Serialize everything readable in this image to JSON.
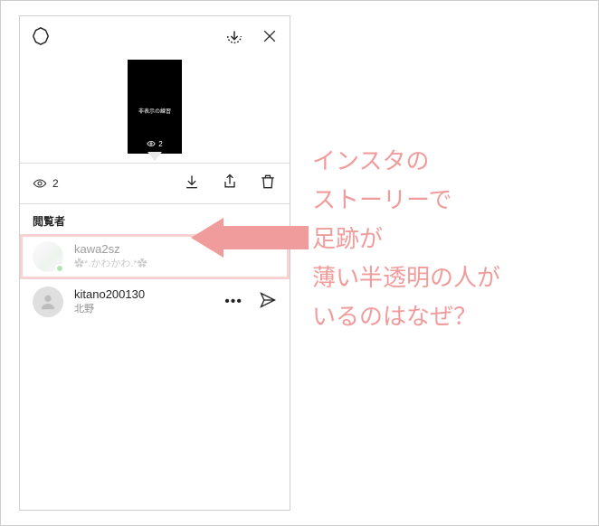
{
  "topbar": {
    "settings_icon": "settings",
    "save_icon": "save-down",
    "close_icon": "close"
  },
  "story_preview": {
    "caption": "非表示の練習",
    "view_count": "2"
  },
  "toolbar": {
    "view_count": "2",
    "download_icon": "download",
    "share_icon": "share",
    "trash_icon": "trash"
  },
  "viewers_section_title": "閲覧者",
  "viewers": [
    {
      "username": "kawa2sz",
      "displayname": "✿*.かわかわ.*✿",
      "online": true,
      "faded": true,
      "highlighted": true
    },
    {
      "username": "kitano200130",
      "displayname": "北野",
      "online": false,
      "faded": false,
      "highlighted": false
    }
  ],
  "annotation": {
    "line1": "インスタの",
    "line2": "ストーリーで",
    "line3": "足跡が",
    "line4": "薄い半透明の人が",
    "line5": "いるのはなぜ？"
  },
  "colors": {
    "accent_pink": "#f19c9c",
    "online_green": "#56c453"
  }
}
